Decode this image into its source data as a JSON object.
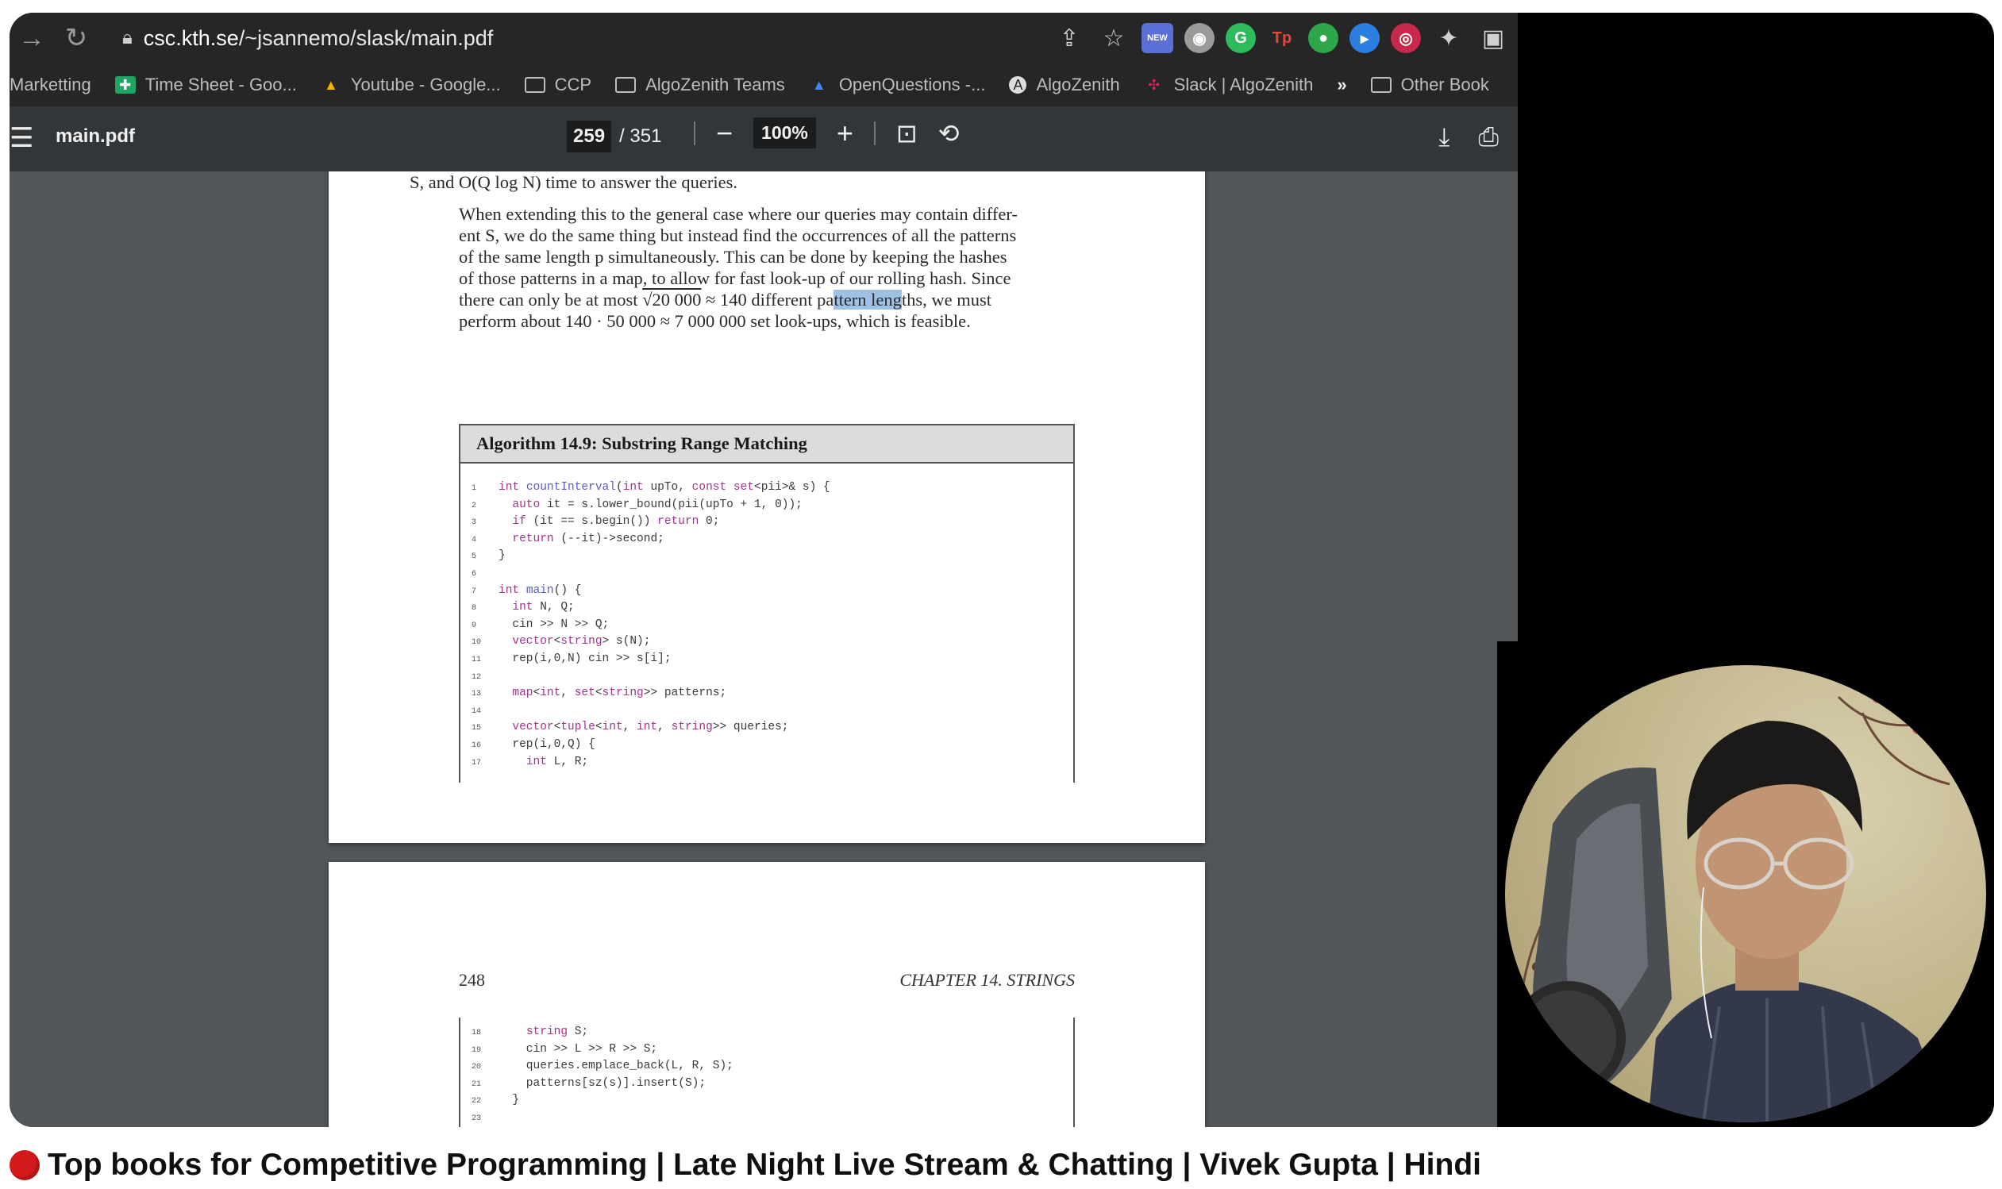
{
  "browser": {
    "url_host": "csc.kth.se",
    "url_path": "/~jsannemo/slask/main.pdf",
    "ext_new_badge": "NEW",
    "bookmarks": [
      {
        "label": "Marketting",
        "icon": "none"
      },
      {
        "label": "Time Sheet - Goo...",
        "icon": "sheets-icon"
      },
      {
        "label": "Youtube - Google...",
        "icon": "drive-icon"
      },
      {
        "label": "CCP",
        "icon": "folder-icon"
      },
      {
        "label": "AlgoZenith Teams",
        "icon": "folder-icon"
      },
      {
        "label": "OpenQuestions -...",
        "icon": "drive-icon"
      },
      {
        "label": "AlgoZenith",
        "icon": "algozenith-icon"
      },
      {
        "label": "Slack | AlgoZenith",
        "icon": "slack-icon"
      },
      {
        "label": "»",
        "icon": "none"
      },
      {
        "label": "Other Book",
        "icon": "folder-icon"
      }
    ]
  },
  "pdf": {
    "title": "main.pdf",
    "current_page": "259",
    "total_pages": "/ 351",
    "zoom": "100%",
    "page1": {
      "top_line": "S, and O(Q log N) time to answer the queries.",
      "para_lines": [
        "When extending this to the general case where our queries may contain differ-",
        "ent S, we do the same thing but instead find the occurrences of all the patterns",
        "of the same length p simultaneously. This can be done by keeping the hashes",
        "of those patterns in a map, to allow for fast look-up of our rolling hash. Since"
      ],
      "line5_a": "there can only be at most ",
      "line5_sqrt": "√20 000",
      "line5_b": " ≈ 140 different pa",
      "line5_hl": "ttern leng",
      "line5_c": "ths, we must",
      "line6": "perform about 140 · 50 000 ≈ 7 000 000 set look-ups, which is feasible.",
      "algo_title": "Algorithm 14.9: Substring Range Matching",
      "code": [
        {
          "n": "1",
          "t": "int countInterval(int upTo, const set<pii>& s) {"
        },
        {
          "n": "2",
          "t": "  auto it = s.lower_bound(pii(upTo + 1, 0));"
        },
        {
          "n": "3",
          "t": "  if (it == s.begin()) return 0;"
        },
        {
          "n": "4",
          "t": "  return (--it)->second;"
        },
        {
          "n": "5",
          "t": "}"
        },
        {
          "n": "6",
          "t": ""
        },
        {
          "n": "7",
          "t": "int main() {"
        },
        {
          "n": "8",
          "t": "  int N, Q;"
        },
        {
          "n": "9",
          "t": "  cin >> N >> Q;"
        },
        {
          "n": "10",
          "t": "  vector<string> s(N);"
        },
        {
          "n": "11",
          "t": "  rep(i,0,N) cin >> s[i];"
        },
        {
          "n": "12",
          "t": ""
        },
        {
          "n": "13",
          "t": "  map<int, set<string>> patterns;"
        },
        {
          "n": "14",
          "t": ""
        },
        {
          "n": "15",
          "t": "  vector<tuple<int, int, string>> queries;"
        },
        {
          "n": "16",
          "t": "  rep(i,0,Q) {"
        },
        {
          "n": "17",
          "t": "    int L, R;"
        }
      ]
    },
    "page2": {
      "page_number": "248",
      "chapter": "CHAPTER 14.  STRINGS",
      "code": [
        {
          "n": "18",
          "t": "    string S;"
        },
        {
          "n": "19",
          "t": "    cin >> L >> R >> S;"
        },
        {
          "n": "20",
          "t": "    queries.emplace_back(L, R, S);"
        },
        {
          "n": "21",
          "t": "    patterns[sz(s)].insert(S);"
        },
        {
          "n": "22",
          "t": "  }"
        },
        {
          "n": "23",
          "t": ""
        }
      ]
    }
  },
  "video_title": "Top books for Competitive Programming | Late Night Live Stream & Chatting | Vivek Gupta | Hindi",
  "colors": {
    "live_dot": "#d3191c",
    "pdf_toolbar": "#323639",
    "pdf_canvas": "#525659",
    "selection": "#9fc1e6"
  }
}
